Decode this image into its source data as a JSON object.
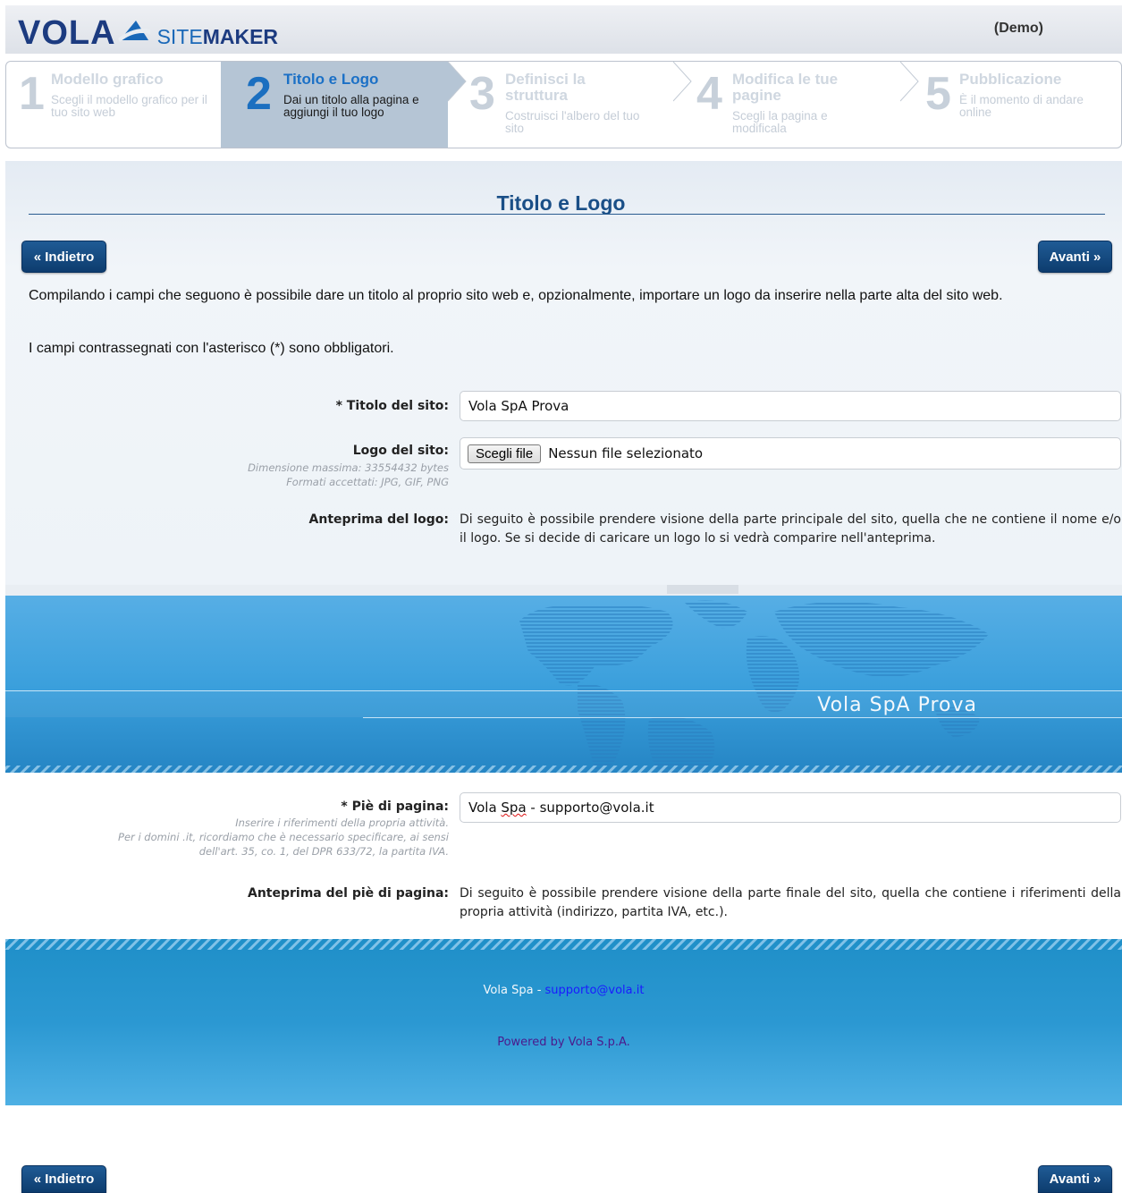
{
  "header": {
    "brand_main": "VOLA",
    "brand_site": "SITE",
    "brand_maker": "MAKER",
    "demo_label": "(Demo)"
  },
  "steps": [
    {
      "num": "1",
      "title": "Modello grafico",
      "desc": "Scegli il modello grafico per il tuo sito web",
      "active": false
    },
    {
      "num": "2",
      "title": "Titolo e Logo",
      "desc": "Dai un titolo alla pagina e aggiungi il tuo logo",
      "active": true
    },
    {
      "num": "3",
      "title": "Definisci la struttura",
      "desc": "Costruisci l'albero del tuo sito",
      "active": false
    },
    {
      "num": "4",
      "title": "Modifica le tue pagine",
      "desc": "Scegli la pagina e modificala",
      "active": false
    },
    {
      "num": "5",
      "title": "Pubblicazione",
      "desc": "È il momento di andare online",
      "active": false
    }
  ],
  "page": {
    "title": "Titolo e Logo",
    "back_label": "« Indietro",
    "next_label": "Avanti »",
    "intro": "Compilando i campi che seguono è possibile dare un titolo al proprio sito web e, opzionalmente, importare un logo da inserire nella parte alta del sito web.",
    "required_note": "I campi contrassegnati con l'asterisco (*) sono obbligatori."
  },
  "form": {
    "site_title_label": "* Titolo del sito:",
    "site_title_value": "Vola SpA Prova",
    "logo_label": "Logo del sito:",
    "logo_hint_1": "Dimensione massima: 33554432 bytes",
    "logo_hint_2": "Formati accettati: JPG, GIF, PNG",
    "file_button_label": "Scegli file",
    "file_status": "Nessun file selezionato",
    "logo_preview_label": "Anteprima del logo:",
    "logo_preview_text": "Di seguito è possibile prendere visione della parte principale del sito, quella che ne contiene il nome e/o il logo. Se si decide di caricare un logo lo si vedrà comparire nell'anteprima.",
    "banner_title": "Vola SpA Prova",
    "footer_label": "* Piè di pagina:",
    "footer_hint_1": "Inserire i riferimenti della propria attività.",
    "footer_hint_2": "Per i domini .it, ricordiamo che è necessario specificare, ai sensi",
    "footer_hint_3": "dell'art. 35, co. 1, del DPR 633/72, la partita IVA.",
    "footer_value_a": "Vola ",
    "footer_value_b": "Spa",
    "footer_value_c": " - supporto@vola.it",
    "footer_preview_label": "Anteprima del piè di pagina:",
    "footer_preview_text": "Di seguito è possibile prendere visione della parte finale del sito, quella che contiene i riferimenti della propria attività (indirizzo, partita IVA, etc.)."
  },
  "footer_preview": {
    "company": "Vola Spa",
    "separator": " - ",
    "email": "supporto@vola.it",
    "powered": "Powered by Vola S.p.A."
  },
  "colors": {
    "brand_navy": "#1c3b80",
    "accent_blue": "#1b70c6",
    "button": "#0f426f",
    "banner_blue": "#3a9fdc"
  }
}
